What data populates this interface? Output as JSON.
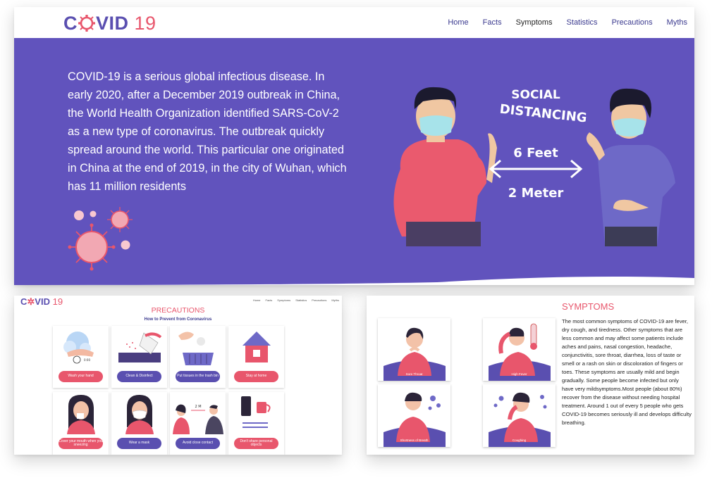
{
  "brand": {
    "name_left": "C",
    "name_mid": "VID",
    "name_num": "19",
    "primary": "#5a4fb0",
    "accent": "#e8566c",
    "hero_bg": "#6153bd"
  },
  "nav": [
    "Home",
    "Facts",
    "Symptoms",
    "Statistics",
    "Precautions",
    "Myths"
  ],
  "hero": {
    "text": "COVID-19 is a serious global infectious disease. In early 2020, after a December 2019 outbreak in China, the World Health Organization identified SARS-CoV-2 as a new type of coronavirus. The outbreak quickly spread around the world. This particular one originated in China at the end of 2019, in the city of Wuhan, which has 11 million residents",
    "illustration": {
      "title_line1": "SOCIAL",
      "title_line2": "DISTANCING",
      "distance_top": "6 Feet",
      "distance_bottom": "2 Meter"
    }
  },
  "mini_nav": [
    "Home",
    "Facts",
    "Symptoms",
    "Statistics",
    "Precautions",
    "Myths"
  ],
  "precautions": {
    "title": "PRECAUTIONS",
    "subtitle": "How to Prevent from Coronavirus",
    "tiles": [
      {
        "label": "Wash your hand",
        "color": "red"
      },
      {
        "label": "Clean & Disinfect",
        "color": "pur"
      },
      {
        "label": "Put tissues in the trash bin",
        "color": "pur"
      },
      {
        "label": "Stay at home",
        "color": "red"
      },
      {
        "label": "Cover your mouth when you sneezing",
        "color": "red"
      },
      {
        "label": "Wear a mask",
        "color": "pur"
      },
      {
        "label": "Avoid close contact",
        "color": "pur"
      },
      {
        "label": "Don't share personal objects",
        "color": "red"
      }
    ],
    "distance_mark": "2 M",
    "clock_text": "0:00"
  },
  "symptoms": {
    "title": "SYMPTOMS",
    "text": "The most common symptoms of COVID-19 are fever, dry cough, and tiredness. Other symptoms that are less common and may affect some patients include aches and pains, nasal congestion, headache, conjunctivitis, sore throat, diarrhea, loss of taste or smell or a rash on skin or discoloration of fingers or toes. These symptoms are usually mild and begin gradually. Some people become infected but only have very mildsymptoms.Most people (about 80%) recover from the disease without needing hospital treatment. Around 1 out of every 5 people who gets COVID-19 becomes seriously ill and develops difficulty breathing.",
    "tiles": [
      {
        "label": "Sore Throat"
      },
      {
        "label": "High Fever"
      },
      {
        "label": "Shortness of Breath"
      },
      {
        "label": "Coughing"
      }
    ]
  }
}
